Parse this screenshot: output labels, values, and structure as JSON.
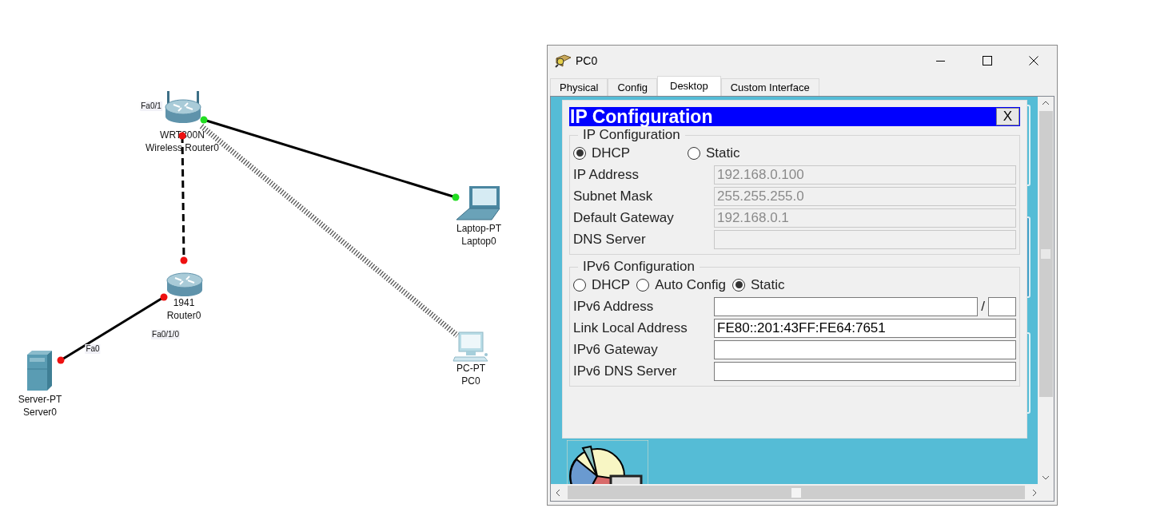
{
  "canvas": {
    "devices": [
      {
        "kind": "wireless_router",
        "model": "WRT300N",
        "name": "Wireless Router0"
      },
      {
        "kind": "router",
        "model": "1941",
        "name": "Router0"
      },
      {
        "kind": "server",
        "model": "Server-PT",
        "name": "Server0"
      },
      {
        "kind": "laptop",
        "model": "Laptop-PT",
        "name": "Laptop0"
      },
      {
        "kind": "pc",
        "model": "PC-PT",
        "name": "PC0"
      }
    ],
    "links": [
      {
        "kind": "straight",
        "color": "#22dd22"
      },
      {
        "kind": "crossover",
        "color": "#ee1111"
      },
      {
        "kind": "straight",
        "color": "#ee1111"
      },
      {
        "kind": "wireless"
      }
    ],
    "port_labels": [
      "Fa0/1",
      "Fa0/1/0",
      "Fa0"
    ]
  },
  "window": {
    "title": "PC0",
    "tabs": [
      {
        "label": "Physical",
        "selected": false
      },
      {
        "label": "Config",
        "selected": false
      },
      {
        "label": "Desktop",
        "selected": true
      },
      {
        "label": "Custom Interface",
        "selected": false
      }
    ]
  },
  "dialog": {
    "title": "IP Configuration",
    "close": "X",
    "ipv4": {
      "legend": "IP Configuration",
      "modes": [
        {
          "label": "DHCP",
          "selected": true
        },
        {
          "label": "Static",
          "selected": false
        }
      ],
      "fields": [
        {
          "label": "IP Address",
          "value": "192.168.0.100",
          "disabled": true
        },
        {
          "label": "Subnet Mask",
          "value": "255.255.255.0",
          "disabled": true
        },
        {
          "label": "Default Gateway",
          "value": "192.168.0.1",
          "disabled": true
        },
        {
          "label": "DNS Server",
          "disabled": true
        }
      ]
    },
    "ipv6": {
      "legend": "IPv6 Configuration",
      "modes": [
        {
          "label": "DHCP",
          "selected": false
        },
        {
          "label": "Auto Config",
          "selected": false
        },
        {
          "label": "Static",
          "selected": true
        }
      ],
      "fields": [
        {
          "label": "IPv6 Address",
          "disabled": false,
          "kind": "address_prefix",
          "separator": "/"
        },
        {
          "label": "Link Local Address",
          "value": "FE80::201:43FF:FE64:7651",
          "disabled": false
        },
        {
          "label": "IPv6 Gateway",
          "disabled": false
        },
        {
          "label": "IPv6 DNS Server",
          "disabled": false
        }
      ]
    }
  }
}
